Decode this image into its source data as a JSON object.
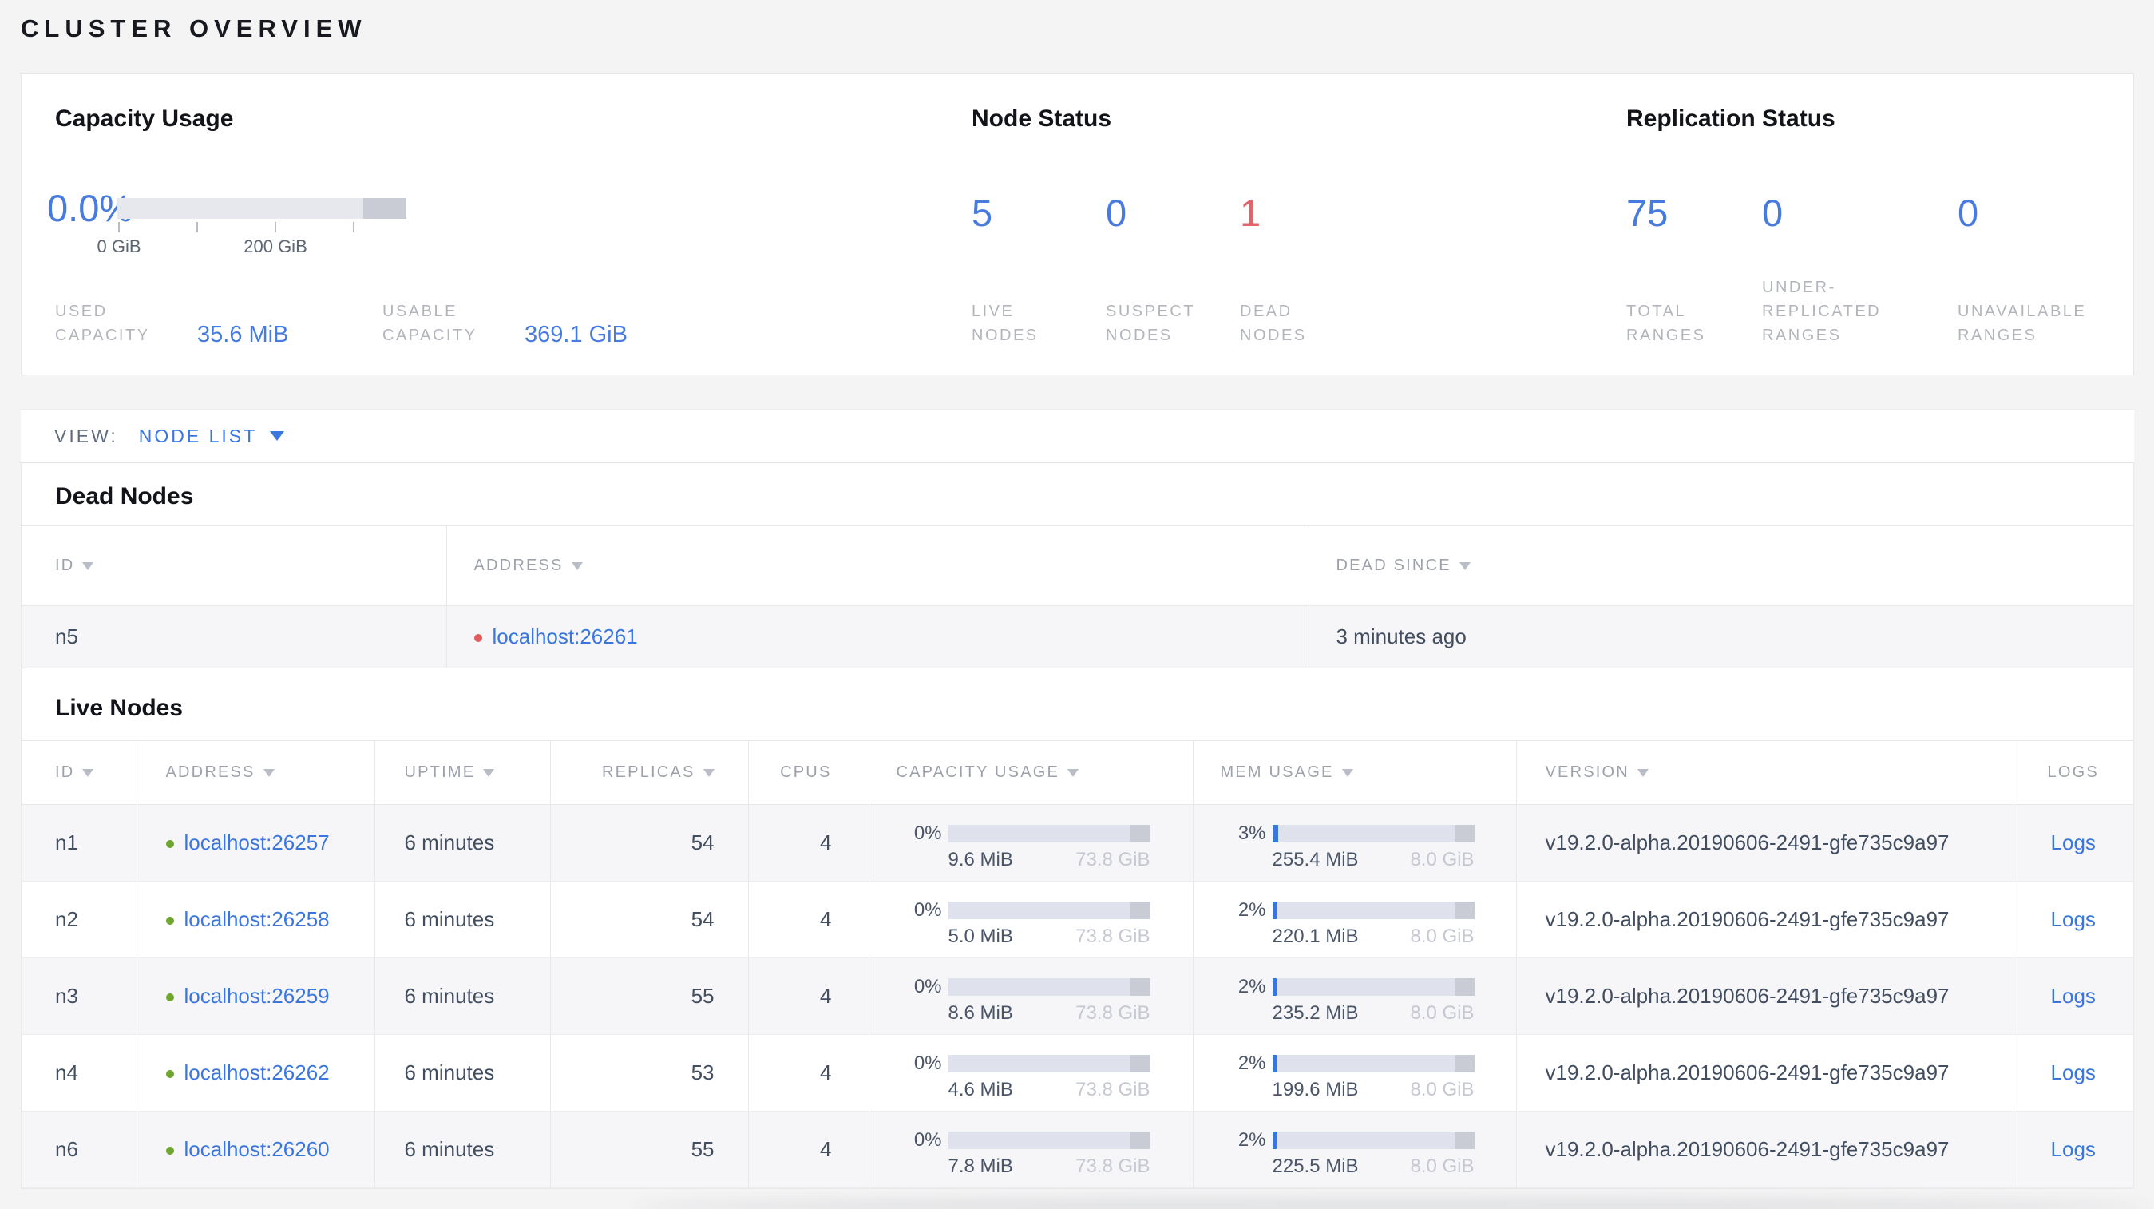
{
  "page_title": "CLUSTER OVERVIEW",
  "colors": {
    "accent_blue": "#487bdf",
    "link_blue": "#3a76dd",
    "danger_red": "#e0646a",
    "dot_red": "#e25c5e",
    "success_green": "#6ea52e",
    "bar_fill_blue": "#3b74dd"
  },
  "summary": {
    "capacity": {
      "title": "Capacity Usage",
      "percent": "0.0%",
      "axis_ticks": [
        "0 GiB",
        "200 GiB"
      ],
      "stats": [
        {
          "label": "USED CAPACITY",
          "value": "35.6 MiB"
        },
        {
          "label": "USABLE CAPACITY",
          "value": "369.1 GiB"
        }
      ]
    },
    "node_status": {
      "title": "Node Status",
      "metrics": [
        {
          "value": "5",
          "label": "LIVE NODES"
        },
        {
          "value": "0",
          "label": "SUSPECT NODES"
        },
        {
          "value": "1",
          "label": "DEAD NODES"
        }
      ]
    },
    "replication": {
      "title": "Replication Status",
      "metrics": [
        {
          "value": "75",
          "label": "TOTAL RANGES"
        },
        {
          "value": "0",
          "label": "UNDER-REPLICATED RANGES"
        },
        {
          "value": "0",
          "label": "UNAVAILABLE RANGES"
        }
      ]
    }
  },
  "view_bar": {
    "label": "VIEW:",
    "selected": "NODE LIST"
  },
  "dead_nodes": {
    "title": "Dead Nodes",
    "columns": [
      {
        "label": "ID"
      },
      {
        "label": "ADDRESS"
      },
      {
        "label": "DEAD SINCE"
      }
    ],
    "rows": [
      {
        "id": "n5",
        "address": "localhost:26261",
        "dead_since": "3 minutes ago"
      }
    ]
  },
  "live_nodes": {
    "title": "Live Nodes",
    "columns": [
      {
        "label": "ID"
      },
      {
        "label": "ADDRESS"
      },
      {
        "label": "UPTIME"
      },
      {
        "label": "REPLICAS"
      },
      {
        "label": "CPUS"
      },
      {
        "label": "CAPACITY USAGE"
      },
      {
        "label": "MEM USAGE"
      },
      {
        "label": "VERSION"
      },
      {
        "label": "LOGS"
      }
    ],
    "rows": [
      {
        "id": "n1",
        "address": "localhost:26257",
        "uptime": "6 minutes",
        "replicas": "54",
        "cpus": "4",
        "capacity": {
          "percent": "0%",
          "used": "9.6 MiB",
          "total": "73.8 GiB"
        },
        "memory": {
          "percent": "3%",
          "used": "255.4 MiB",
          "total": "8.0 GiB"
        },
        "version": "v19.2.0-alpha.20190606-2491-gfe735c9a97",
        "logs": "Logs"
      },
      {
        "id": "n2",
        "address": "localhost:26258",
        "uptime": "6 minutes",
        "replicas": "54",
        "cpus": "4",
        "capacity": {
          "percent": "0%",
          "used": "5.0 MiB",
          "total": "73.8 GiB"
        },
        "memory": {
          "percent": "2%",
          "used": "220.1 MiB",
          "total": "8.0 GiB"
        },
        "version": "v19.2.0-alpha.20190606-2491-gfe735c9a97",
        "logs": "Logs"
      },
      {
        "id": "n3",
        "address": "localhost:26259",
        "uptime": "6 minutes",
        "replicas": "55",
        "cpus": "4",
        "capacity": {
          "percent": "0%",
          "used": "8.6 MiB",
          "total": "73.8 GiB"
        },
        "memory": {
          "percent": "2%",
          "used": "235.2 MiB",
          "total": "8.0 GiB"
        },
        "version": "v19.2.0-alpha.20190606-2491-gfe735c9a97",
        "logs": "Logs"
      },
      {
        "id": "n4",
        "address": "localhost:26262",
        "uptime": "6 minutes",
        "replicas": "53",
        "cpus": "4",
        "capacity": {
          "percent": "0%",
          "used": "4.6 MiB",
          "total": "73.8 GiB"
        },
        "memory": {
          "percent": "2%",
          "used": "199.6 MiB",
          "total": "8.0 GiB"
        },
        "version": "v19.2.0-alpha.20190606-2491-gfe735c9a97",
        "logs": "Logs"
      },
      {
        "id": "n6",
        "address": "localhost:26260",
        "uptime": "6 minutes",
        "replicas": "55",
        "cpus": "4",
        "capacity": {
          "percent": "0%",
          "used": "7.8 MiB",
          "total": "73.8 GiB"
        },
        "memory": {
          "percent": "2%",
          "used": "225.5 MiB",
          "total": "8.0 GiB"
        },
        "version": "v19.2.0-alpha.20190606-2491-gfe735c9a97",
        "logs": "Logs"
      }
    ]
  }
}
